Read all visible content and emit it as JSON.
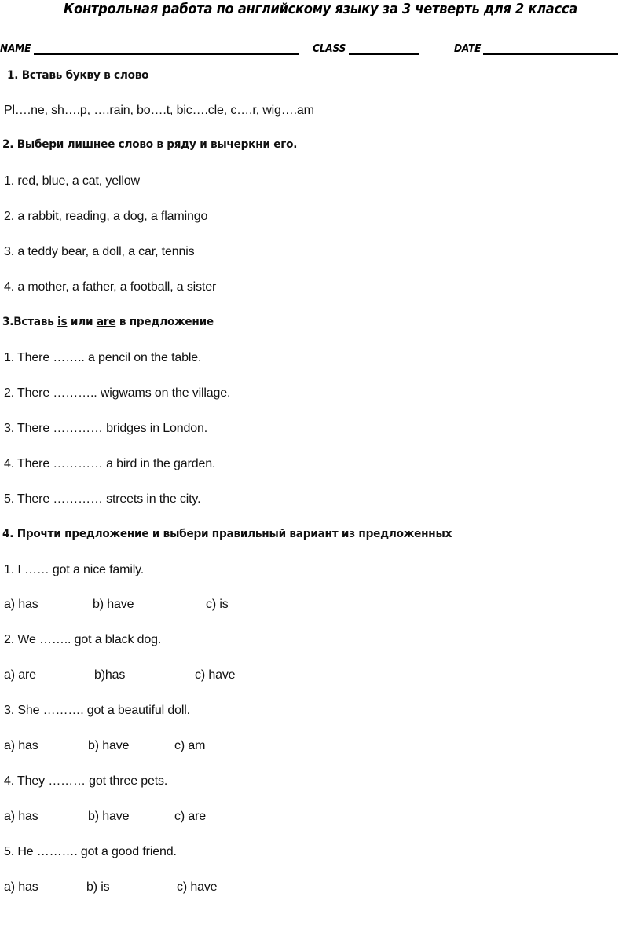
{
  "document": {
    "title": "Контрольная работа по английскому языку за 3 четверть  для 2  класса",
    "id_fields": {
      "name_label": "NAME",
      "class_label": "CLASS",
      "date_label": "DATE"
    }
  },
  "tasks": [
    {
      "id": "task-1",
      "heading": "1. Вставь букву в слово",
      "content": "Pl….ne,  sh….p,  ….rain,  bo….t, bic….cle, c….r, wig….am"
    },
    {
      "id": "task-2",
      "heading": "2. Выбери лишнее слово в ряду и вычеркни его.",
      "items": [
        "1. red,  blue,  a cat,  yellow",
        "2. a rabbit,  reading,  a dog,  a flamingo",
        "3. a teddy bear,  a doll,  a car,  tennis",
        "4. a mother,  a father,  a football,  a sister"
      ]
    },
    {
      "id": "task-3",
      "heading_parts": {
        "prefix": "3.Вставь ",
        "word1": "is",
        "middle": "  или ",
        "word2": "are",
        "suffix": " в предложение"
      },
      "items": [
        "1. There …….. a pencil on the table.",
        "2. There ……….. wigwams on the village.",
        "3. There ………… bridges in London.",
        "4. There ………… a bird in the garden.",
        "5. There ………… streets in the city."
      ]
    },
    {
      "id": "task-4",
      "heading": "4. Прочти предложение и выбери правильный вариант из предложенных",
      "questions": [
        {
          "prompt": "1. I …… got a nice family.",
          "options": [
            "a) has",
            "b) have",
            "c) is"
          ]
        },
        {
          "prompt": "2. We …….. got a black dog.",
          "options": [
            "a) are",
            "b)has",
            "c) have"
          ]
        },
        {
          "prompt": "3. She ………. got a beautiful doll.",
          "options": [
            "a) has",
            "b) have",
            "c) am"
          ]
        },
        {
          "prompt": "4. They ……… got three pets.",
          "options": [
            "a) has",
            "b) have",
            "c) are"
          ]
        },
        {
          "prompt": "5. He ………. got a good friend.",
          "options": [
            "a) has",
            "b) is",
            "c) have"
          ]
        }
      ]
    }
  ]
}
